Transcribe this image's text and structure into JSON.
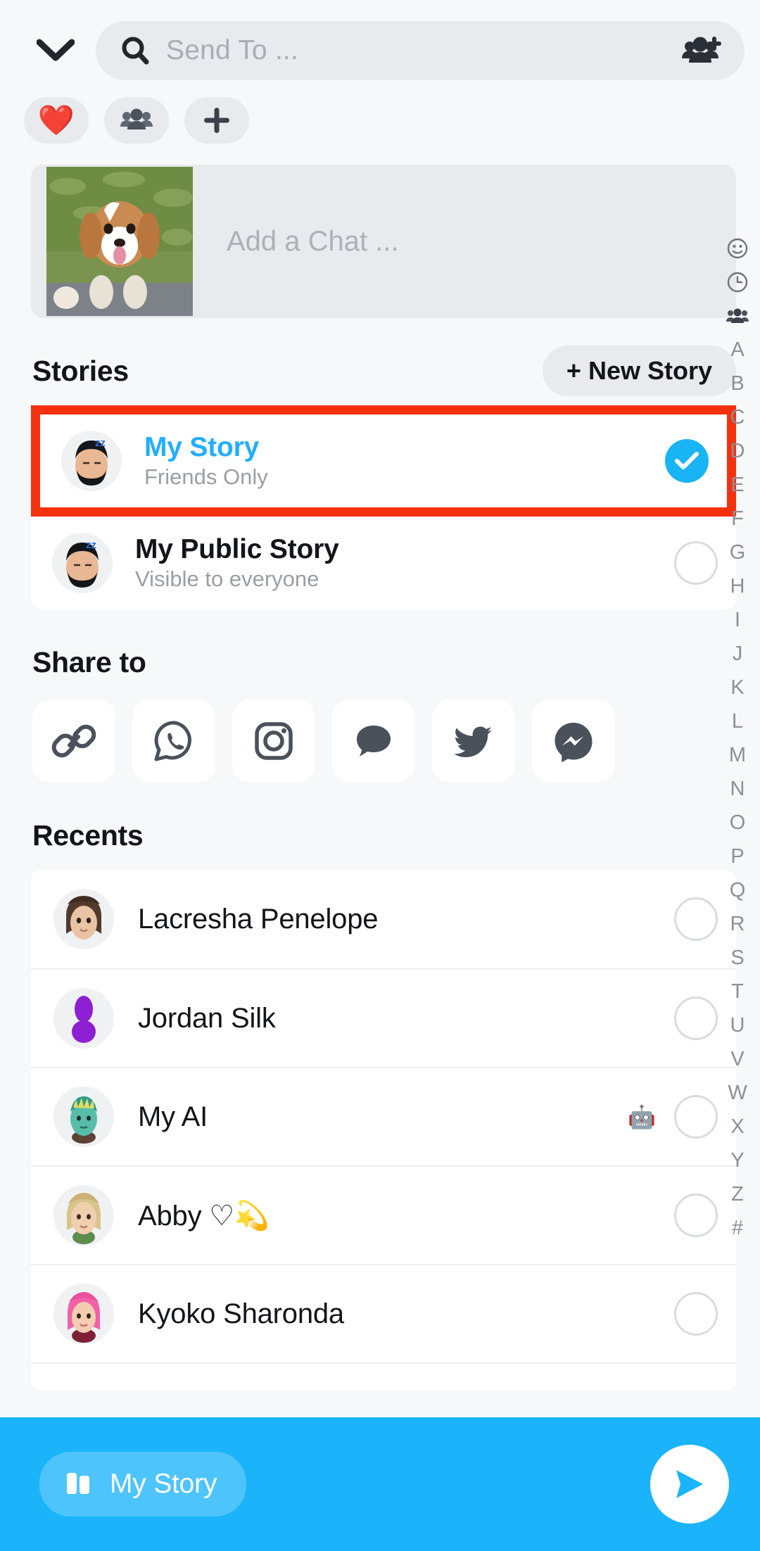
{
  "header": {
    "collapse_icon": "chevron-down-icon",
    "search": {
      "placeholder": "Send To ...",
      "icon": "search-icon"
    },
    "add_friends_icon": "add-friends-icon"
  },
  "filter_chips": [
    {
      "name": "best-friends-chip",
      "icon": "heart-icon",
      "glyph": "❤️",
      "color": "#EC3B2F"
    },
    {
      "name": "groups-chip",
      "icon": "group-icon"
    },
    {
      "name": "new-chip",
      "icon": "plus-icon"
    }
  ],
  "add_chat": {
    "placeholder": "Add a Chat ...",
    "thumbnail": "puppy-photo-thumbnail"
  },
  "stories": {
    "title": "Stories",
    "new_story_button": "+ New Story",
    "items": [
      {
        "name": "My Story",
        "subtitle": "Friends Only",
        "selected": true,
        "highlighted": true,
        "title_color": "#23AEFC",
        "avatar": "bitmoji-sleeping-avatar"
      },
      {
        "name": "My Public Story",
        "subtitle": "Visible to everyone",
        "selected": false,
        "highlighted": false,
        "title_color": "#12151A",
        "avatar": "bitmoji-sleeping-avatar"
      }
    ]
  },
  "share_to": {
    "title": "Share to",
    "targets": [
      {
        "label": "Copy Link",
        "icon": "link-icon"
      },
      {
        "label": "WhatsApp",
        "icon": "whatsapp-icon"
      },
      {
        "label": "Instagram",
        "icon": "instagram-icon"
      },
      {
        "label": "Messages",
        "icon": "sms-bubble-icon"
      },
      {
        "label": "Twitter",
        "icon": "twitter-bird-icon"
      },
      {
        "label": "Messenger",
        "icon": "messenger-icon"
      }
    ]
  },
  "recents": {
    "title": "Recents",
    "contacts": [
      {
        "name": "Lacresha Penelope",
        "badge": "",
        "selected": false,
        "avatar": "bitmoji-brown-hair"
      },
      {
        "name": "Jordan Silk",
        "badge": "",
        "selected": false,
        "avatar": "default-purple-avatar"
      },
      {
        "name": "My AI",
        "badge": "🤖",
        "selected": false,
        "avatar": "bitmoji-teal-hair"
      },
      {
        "name": "Abby ♡💫",
        "badge": "",
        "selected": false,
        "avatar": "bitmoji-blonde-hair"
      },
      {
        "name": "Kyoko Sharonda",
        "badge": "",
        "selected": false,
        "avatar": "bitmoji-pink-hair"
      }
    ]
  },
  "index_rail": {
    "icons": [
      "smiley-icon",
      "clock-icon",
      "group-icon"
    ],
    "letters": [
      "A",
      "B",
      "C",
      "D",
      "E",
      "F",
      "G",
      "H",
      "I",
      "J",
      "K",
      "L",
      "M",
      "N",
      "O",
      "P",
      "Q",
      "R",
      "S",
      "T",
      "U",
      "V",
      "W",
      "X",
      "Y",
      "Z",
      "#"
    ]
  },
  "bottom_bar": {
    "selected_label": "My Story",
    "selected_icon": "story-cards-icon",
    "send_icon": "send-arrow-icon",
    "background_color": "#1BB4FA"
  },
  "annotation": {
    "highlight_color": "#F4310F",
    "target": "My Story"
  }
}
